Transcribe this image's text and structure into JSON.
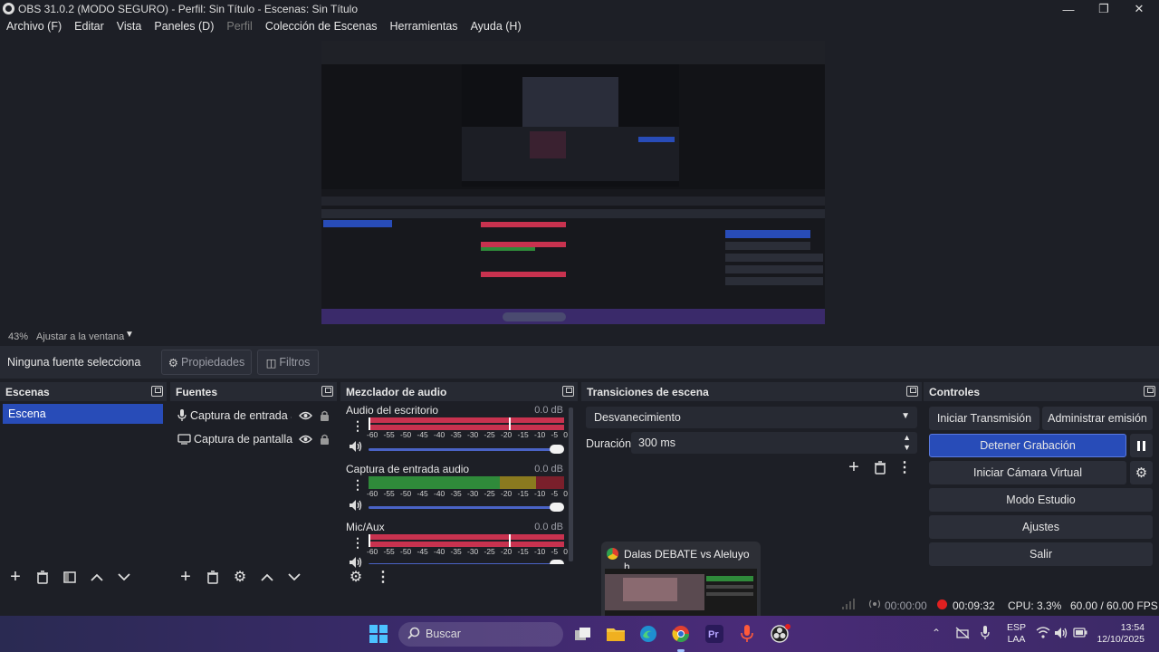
{
  "window": {
    "title": "OBS 31.0.2 (MODO SEGURO) - Perfil: Sin Título - Escenas: Sin Título",
    "icon": "obs-logo-icon"
  },
  "menu": {
    "items": [
      {
        "label": "Archivo (F)"
      },
      {
        "label": "Editar"
      },
      {
        "label": "Vista"
      },
      {
        "label": "Paneles (D)"
      },
      {
        "label": "Perfil",
        "disabled": true
      },
      {
        "label": "Colección de Escenas"
      },
      {
        "label": "Herramientas"
      },
      {
        "label": "Ayuda (H)"
      }
    ]
  },
  "zoom": {
    "percent": "43%",
    "mode": "Ajustar a la ventana"
  },
  "source_toolbar": {
    "status": "Ninguna fuente selecciona",
    "properties": "Propiedades",
    "filters": "Filtros"
  },
  "scenes": {
    "title": "Escenas",
    "items": [
      "Escena"
    ]
  },
  "sources": {
    "title": "Fuentes",
    "items": [
      {
        "label": "Captura de entrada au",
        "icon": "microphone-icon"
      },
      {
        "label": "Captura de pantalla",
        "icon": "monitor-icon"
      }
    ]
  },
  "mixer": {
    "title": "Mezclador de audio",
    "ticks": [
      "-60",
      "-55",
      "-50",
      "-45",
      "-40",
      "-35",
      "-30",
      "-25",
      "-20",
      "-15",
      "-10",
      "-5",
      "0"
    ],
    "channels": [
      {
        "name": "Audio del escritorio",
        "db": "0.0 dB"
      },
      {
        "name": "Captura de entrada audio",
        "db": "0.0 dB"
      },
      {
        "name": "Mic/Aux",
        "db": "0.0 dB"
      }
    ]
  },
  "transitions": {
    "title": "Transiciones de escena",
    "selected": "Desvanecimiento",
    "duration_label": "Duración",
    "duration_value": "300 ms"
  },
  "controls": {
    "title": "Controles",
    "start_stream": "Iniciar Transmisión",
    "manage_stream": "Administrar emisión",
    "stop_recording": "Detener Grabación",
    "start_virtual_cam": "Iniciar Cámara Virtual",
    "studio_mode": "Modo Estudio",
    "settings": "Ajustes",
    "exit": "Salir"
  },
  "status": {
    "stream_time": "00:00:00",
    "rec_time": "00:09:32",
    "cpu": "CPU: 3.3%",
    "fps": "60.00 / 60.00 FPS"
  },
  "thumbnail": {
    "title": "Dalas DEBATE vs Aleluyo h..."
  },
  "taskbar": {
    "search": "Buscar",
    "lang_top": "ESP",
    "lang_bottom": "LAA",
    "time": "13:54",
    "date": "12/10/2025"
  },
  "colors": {
    "accent": "#284cb8",
    "meter_red": "#c8324f",
    "meter_green": "#2f8a3a",
    "meter_yellow": "#8a7a1f",
    "rec_red": "#e02020"
  }
}
